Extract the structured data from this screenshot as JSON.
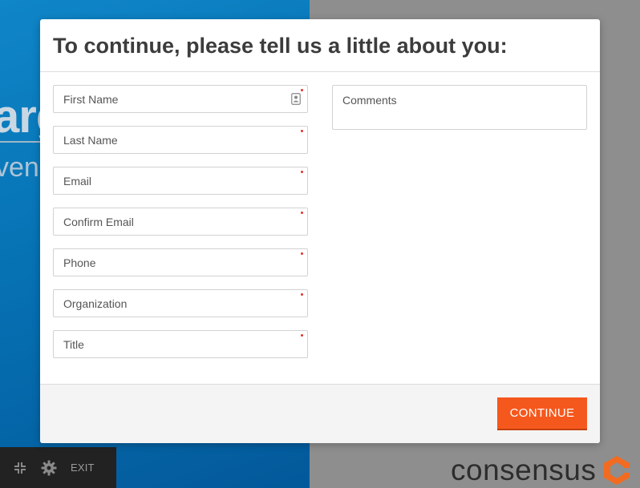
{
  "background": {
    "big_text": "arg",
    "small_text": "ven"
  },
  "modal": {
    "title": "To continue, please tell us a little about you:",
    "fields": [
      {
        "placeholder": "First Name",
        "required": true
      },
      {
        "placeholder": "Last Name",
        "required": true
      },
      {
        "placeholder": "Email",
        "required": true
      },
      {
        "placeholder": "Confirm Email",
        "required": true
      },
      {
        "placeholder": "Phone",
        "required": true
      },
      {
        "placeholder": "Organization",
        "required": true
      },
      {
        "placeholder": "Title",
        "required": true
      }
    ],
    "comments_placeholder": "Comments",
    "continue_label": "CONTINUE"
  },
  "toolbar": {
    "exit_label": "EXIT",
    "icons": [
      "minimize-icon",
      "gear-icon"
    ]
  },
  "logo": {
    "text": "consensus"
  },
  "colors": {
    "accent": "#f5581d",
    "required": "#e0322c",
    "left_panel": "#0672b4",
    "logo_orange": "#f26b21"
  }
}
